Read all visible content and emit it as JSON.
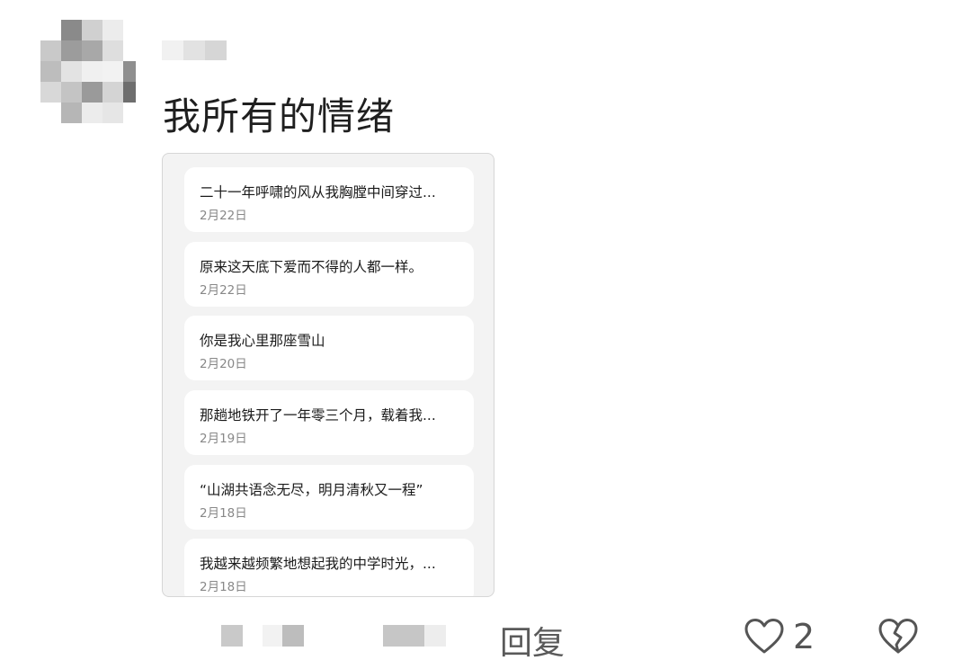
{
  "comment": {
    "avatar_icon": "avatar-pixelated",
    "text": "我所有的情绪",
    "screenshot": {
      "notes": [
        {
          "title": "二十一年呼啸的风从我胸膛中间穿过...",
          "date": "2月22日"
        },
        {
          "title": "原来这天底下爱而不得的人都一样。",
          "date": "2月22日"
        },
        {
          "title": "你是我心里那座雪山",
          "date": "2月20日"
        },
        {
          "title": "那趟地铁开了一年零三个月，载着我...",
          "date": "2月19日"
        },
        {
          "title": "“山湖共语念无尽，明月清秋又一程”",
          "date": "2月18日"
        },
        {
          "title": "我越来越频繁地想起我的中学时光，...",
          "date": "2月18日"
        }
      ]
    },
    "actions": {
      "reply_label": "回复",
      "like_icon": "heart-outline-icon",
      "like_count": "2",
      "dislike_icon": "broken-heart-icon"
    }
  }
}
